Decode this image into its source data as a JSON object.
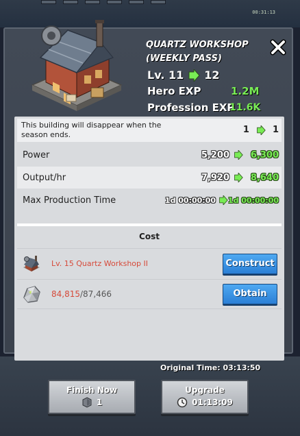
{
  "top_bar": {
    "clock": "00:31:13"
  },
  "dialog": {
    "title": "QUARTZ WORKSHOP (WEEKLY PASS)",
    "level": {
      "label": "Lv. 11",
      "next": "12"
    },
    "hero_exp": {
      "label": "Hero EXP",
      "value": "1.2M"
    },
    "profession_exp": {
      "label": "Profession EXP",
      "value": "11.6K"
    }
  },
  "info": {
    "warning": {
      "text": "This building will disappear when the season ends.",
      "from": "1",
      "to": "1"
    },
    "rows": [
      {
        "label": "Power",
        "from": "5,200",
        "to": "6,300"
      },
      {
        "label": "Output/hr",
        "from": "7,920",
        "to": "8,640"
      },
      {
        "label": "Max Production Time",
        "from": "1d 00:00:00",
        "to": "1d 00:00:00"
      }
    ]
  },
  "cost": {
    "header": "Cost",
    "requirement": {
      "label": "Lv. 15 Quartz Workshop II",
      "button": "Construct"
    },
    "resource": {
      "have": "84,815",
      "need": "87,466",
      "button": "Obtain"
    }
  },
  "bottom": {
    "original_time": "Original Time: 03:13:50",
    "finish_now": {
      "label": "Finish Now",
      "cost": "1"
    },
    "upgrade": {
      "label": "Upgrade",
      "time": "01:13:09"
    }
  },
  "colors": {
    "accent_green": "#79ec55",
    "button_blue": "#2b7fd6",
    "warning_red": "#d64a3a"
  }
}
